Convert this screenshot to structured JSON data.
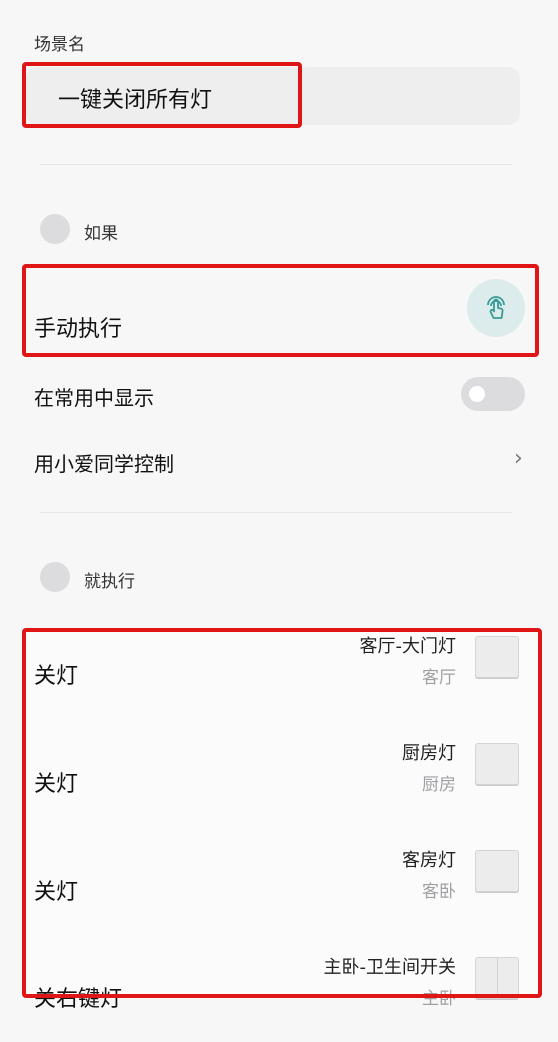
{
  "scene_name": {
    "label": "场景名",
    "value": "一键关闭所有灯"
  },
  "if_section": {
    "label": "如果",
    "trigger": "手动执行",
    "trigger_icon": "touch-icon",
    "show_in_common": "在常用中显示",
    "show_in_common_on": false,
    "xiaoai_control": "用小爱同学控制"
  },
  "then_section": {
    "label": "就执行",
    "actions": [
      {
        "action": "关灯",
        "device": "客厅-大门灯",
        "room": "客厅",
        "icon": "single-switch-icon"
      },
      {
        "action": "关灯",
        "device": "厨房灯",
        "room": "厨房",
        "icon": "single-switch-icon"
      },
      {
        "action": "关灯",
        "device": "客房灯",
        "room": "客卧",
        "icon": "single-switch-icon"
      },
      {
        "action": "关右键灯",
        "device": "主卧-卫生间开关",
        "room": "主卧",
        "icon": "double-switch-icon"
      }
    ]
  },
  "colors": {
    "highlight": "#e01515",
    "touch_button": "#dcecec",
    "icon_teal": "#3a9a96"
  }
}
